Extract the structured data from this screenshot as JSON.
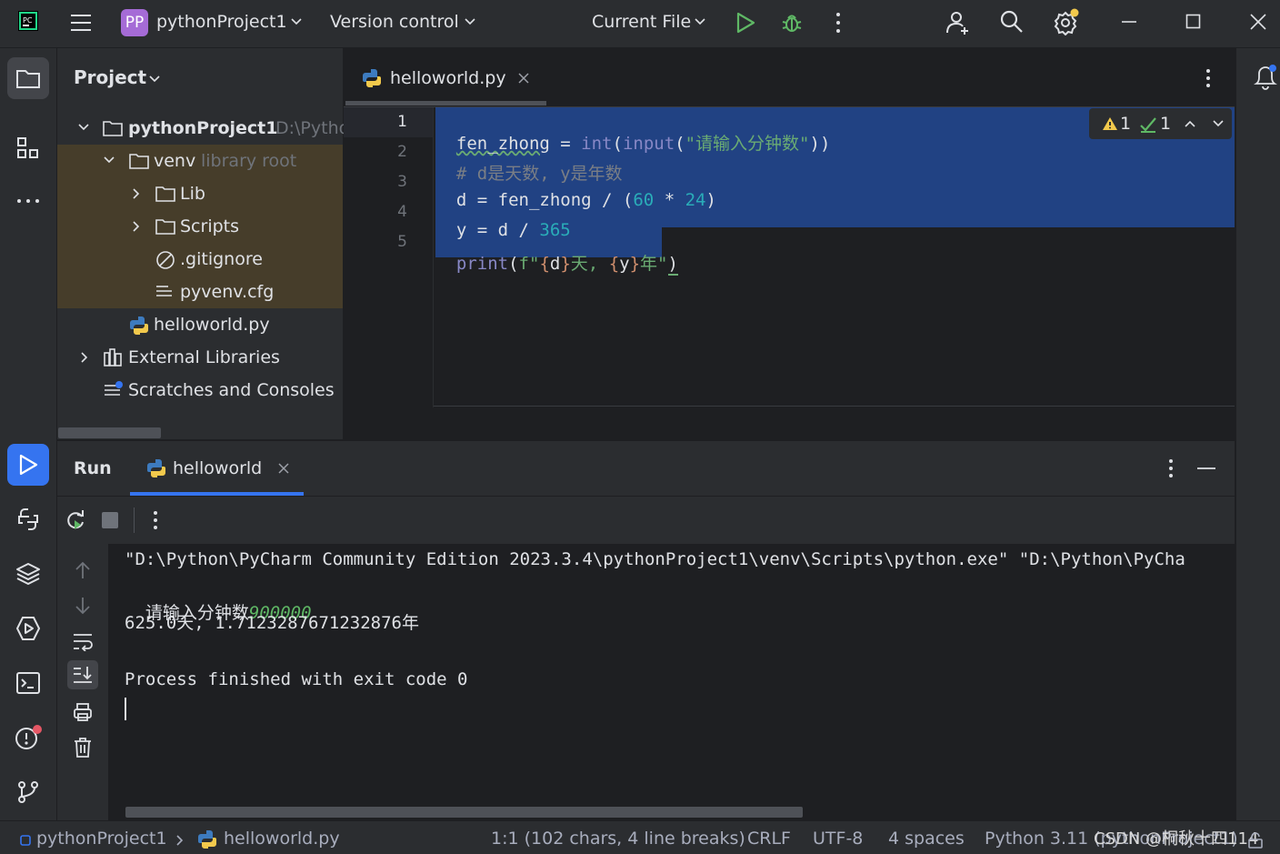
{
  "titlebar": {
    "project_badge": "PP",
    "project_name": "pythonProject1",
    "version_control": "Version control",
    "run_config": "Current File"
  },
  "project_panel": {
    "title": "Project",
    "root_name": "pythonProject1",
    "root_path": "D:\\Pytho",
    "venv": "venv",
    "venv_hint": "library root",
    "lib": "Lib",
    "scripts": "Scripts",
    "gitignore": ".gitignore",
    "pyvenv": "pyvenv.cfg",
    "helloworld": "helloworld.py",
    "external_libraries": "External Libraries",
    "scratches": "Scratches and Consoles"
  },
  "editor": {
    "tab_name": "helloworld.py",
    "inspection": {
      "warnings": "1",
      "weak_warnings": "1"
    },
    "line_numbers": [
      "1",
      "2",
      "3",
      "4",
      "5"
    ],
    "lines": {
      "l1": {
        "a": "fen_zhong",
        "b": " = ",
        "c": "int",
        "d": "(",
        "e": "input",
        "f": "(",
        "g": "\"请输入分钟数\"",
        "h": "))"
      },
      "l2": {
        "a": "# d是天数, y是年数"
      },
      "l3": {
        "a": "d = fen_zhong / (",
        "b": "60",
        "c": " * ",
        "d": "24",
        "e": ")"
      },
      "l4": {
        "a": "y = d / ",
        "b": "365"
      },
      "l5": {
        "a": "print",
        "b": "(",
        "c": "f\"",
        "d": "{",
        "e": "d",
        "f": "}",
        "g": "天, ",
        "h": "{",
        "i": "y",
        "j": "}",
        "k": "年\"",
        "l": ")"
      }
    }
  },
  "run_panel": {
    "title": "Run",
    "tab_name": "helloworld",
    "output": {
      "line1": "\"D:\\Python\\PyCharm Community Edition 2023.3.4\\pythonProject1\\venv\\Scripts\\python.exe\" \"D:\\Python\\PyCha",
      "prompt": "请输入分钟数",
      "input": "900000",
      "result": "625.0天, 1.7123287671232876年",
      "finished": "Process finished with exit code 0"
    }
  },
  "statusbar": {
    "project": "pythonProject1",
    "file": "helloworld.py",
    "position": "1:1 (102 chars, 4 line breaks)",
    "line_sep": "CRLF",
    "encoding": "UTF-8",
    "indent": "4 spaces",
    "interpreter": "Python 3.11 (pythonProject1)",
    "watermark": "CSDN @桐秋十四114"
  },
  "colors": {
    "selection": "#214283",
    "keyword_builtin": "#8888c6",
    "string": "#6aab73",
    "number": "#2aacb8",
    "comment": "#7a7e85",
    "input_green": "#5fb865"
  }
}
